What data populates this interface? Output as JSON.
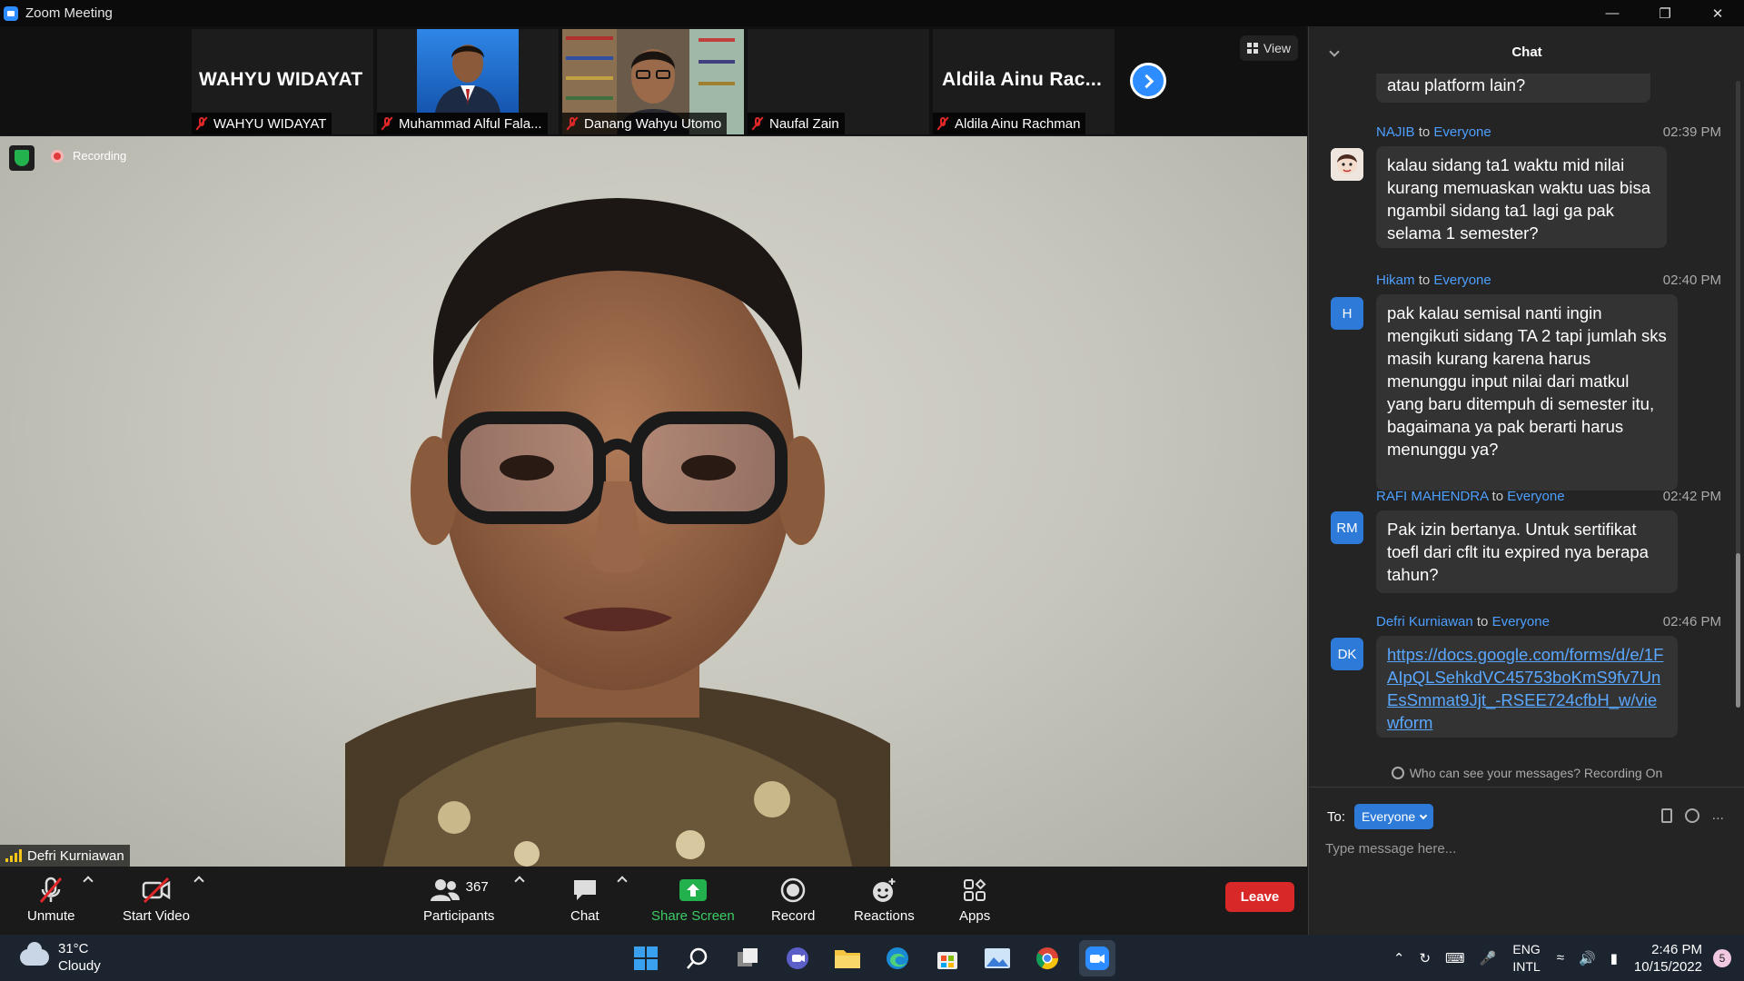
{
  "window": {
    "title": "Zoom Meeting"
  },
  "strip": {
    "participants": [
      {
        "name": "WAHYU WIDAYAT",
        "display": "WAHYU WIDAYAT",
        "has_video": false
      },
      {
        "name": "Muhammad Alful Fala...",
        "has_video": true
      },
      {
        "name": "Danang Wahyu Utomo",
        "has_video": true
      },
      {
        "name": "Naufal Zain",
        "has_video": false
      },
      {
        "name": "Aldila Ainu Rachman",
        "display": "Aldila  Ainu  Rac...",
        "has_video": false
      }
    ],
    "view_label": "View"
  },
  "main": {
    "recording_label": "Recording",
    "speaker_name": "Defri Kurniawan"
  },
  "toolbar": {
    "unmute": "Unmute",
    "start_video": "Start Video",
    "participants": "Participants",
    "participant_count": "367",
    "chat": "Chat",
    "share_screen": "Share Screen",
    "record": "Record",
    "reactions": "Reactions",
    "apps": "Apps",
    "leave": "Leave"
  },
  "chat": {
    "title": "Chat",
    "partial_top": "atau platform lain?",
    "messages": [
      {
        "sender": "NAJIB",
        "to": "to",
        "target": "Everyone",
        "time": "02:39 PM",
        "avatar": "",
        "text": "kalau sidang ta1 waktu mid nilai kurang memuaskan waktu uas bisa ngambil sidang ta1 lagi ga pak selama 1 semester?"
      },
      {
        "sender": "Hikam",
        "to": "to",
        "target": "Everyone",
        "time": "02:40 PM",
        "avatar": "H",
        "text": "pak kalau semisal nanti ingin mengikuti sidang TA 2 tapi jumlah sks masih kurang karena harus menunggu input nilai dari matkul yang baru ditempuh di semester itu, bagaimana ya pak berarti harus menunggu ya?"
      },
      {
        "sender": "RAFI MAHENDRA",
        "to": "to",
        "target": "Everyone",
        "time": "02:42 PM",
        "avatar": "RM",
        "text": "Pak izin bertanya. Untuk sertifikat toefl dari cflt itu expired nya berapa tahun?"
      },
      {
        "sender": "Defri Kurniawan",
        "to": "to",
        "target": "Everyone",
        "time": "02:46 PM",
        "avatar": "DK",
        "text": "https://docs.google.com/forms/d/e/1FAIpQLSehkdVC45753boKmS9fv7UnEsSmmat9Jjt_-RSEE724cfbH_w/viewform"
      }
    ],
    "privacy": "Who can see your messages? Recording On",
    "to_label": "To:",
    "to_value": "Everyone",
    "more": "...",
    "input_placeholder": "Type message here..."
  },
  "taskbar": {
    "temp": "31°C",
    "weather": "Cloudy",
    "lang_top": "ENG",
    "lang_bottom": "INTL",
    "time": "2:46 PM",
    "date": "10/15/2022",
    "notifications": "5"
  },
  "colors": {
    "accent": "#2d8cff",
    "leave": "#d92828",
    "share": "#22b14c",
    "link": "#5aa7ff"
  }
}
